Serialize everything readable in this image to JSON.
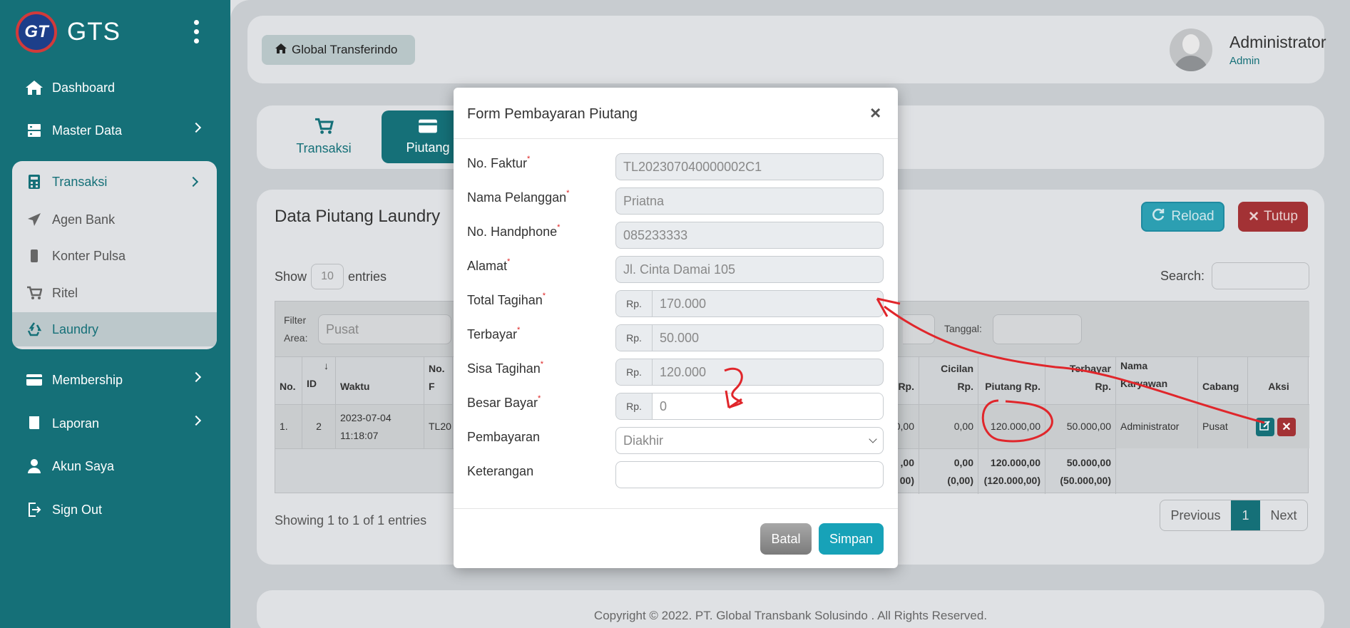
{
  "sidebar": {
    "brand": "GTS",
    "logo_text": "GT",
    "items": {
      "dashboard": "Dashboard",
      "master_data": "Master Data",
      "transaksi": "Transaksi",
      "agen_bank": "Agen Bank",
      "konter_pulsa": "Konter Pulsa",
      "ritel": "Ritel",
      "laundry": "Laundry",
      "membership": "Membership",
      "laporan": "Laporan",
      "akun_saya": "Akun Saya",
      "sign_out": "Sign Out"
    }
  },
  "header": {
    "home_button": "Global Transferindo",
    "user_name": "Administrator",
    "user_role": "Admin"
  },
  "tabs": {
    "transaksi": "Transaksi",
    "piutang": "Piutang"
  },
  "page": {
    "title": "Data Piutang Laundry",
    "reload": "Reload",
    "tutup": "Tutup",
    "show_label": "Show",
    "entries_value": "10",
    "entries_label": "entries",
    "search_label": "Search:",
    "filter_label_1": "Filter",
    "filter_label_2": "Area:",
    "filter_area": "Pusat",
    "tanggal_label": "Tanggal:",
    "showing": "Showing 1 to 1 of 1 entries",
    "pager": {
      "prev": "Previous",
      "page": "1",
      "next": "Next"
    },
    "footer": "Copyright © 2022. PT. Global Transbank Solusindo . All Rights Reserved."
  },
  "table": {
    "headers": {
      "no": "No.",
      "id": "ID",
      "waktu": "Waktu",
      "no_f": "No. F",
      "rp": "Rp.",
      "cicilan": "Cicilan",
      "cicilan2": "Rp.",
      "piutang": "Piutang Rp.",
      "terbayar": "Terbayar",
      "terbayar2": "Rp.",
      "nama1": "Nama",
      "nama2": "Karyawan",
      "cabang": "Cabang",
      "aksi": "Aksi",
      "sort": "↓"
    },
    "row": {
      "no": "1.",
      "id": "2",
      "waktu1": "2023-07-04",
      "waktu2": "11:18:07",
      "no_f": "TL20",
      "rp": "0,00",
      "cicilan": "0,00",
      "piutang": "120.000,00",
      "terbayar": "50.000,00",
      "karyawan": "Administrator",
      "cabang": "Pusat"
    },
    "footer": {
      "rp1": ",00",
      "rp2": "00)",
      "cicilan1": "0,00",
      "cicilan2": "(0,00)",
      "piutang1": "120.000,00",
      "piutang2": "(120.000,00)",
      "terbayar1": "50.000,00",
      "terbayar2": "(50.000,00)"
    }
  },
  "modal": {
    "title": "Form Pembayaran Piutang",
    "close": "×",
    "fields": {
      "no_faktur": {
        "label": "No. Faktur",
        "value": "TL202307040000002C1"
      },
      "nama_pelanggan": {
        "label": "Nama Pelanggan",
        "value": "Priatna"
      },
      "no_handphone": {
        "label": "No. Handphone",
        "value": "085233333"
      },
      "alamat": {
        "label": "Alamat",
        "value": "Jl. Cinta Damai 105"
      },
      "total_tagihan": {
        "label": "Total Tagihan",
        "prefix": "Rp.",
        "value": "170.000"
      },
      "terbayar": {
        "label": "Terbayar",
        "prefix": "Rp.",
        "value": "50.000"
      },
      "sisa_tagihan": {
        "label": "Sisa Tagihan",
        "prefix": "Rp.",
        "value": "120.000"
      },
      "besar_bayar": {
        "label": "Besar Bayar",
        "prefix": "Rp.",
        "value": "0"
      },
      "pembayaran": {
        "label": "Pembayaran",
        "value": "Diakhir"
      },
      "keterangan": {
        "label": "Keterangan",
        "value": ""
      }
    },
    "required_mark": "*",
    "batal": "Batal",
    "simpan": "Simpan"
  },
  "colors": {
    "sidebar": "#157078",
    "accent": "#17a2b8",
    "danger": "#a33235",
    "annotation": "#e0262b"
  }
}
